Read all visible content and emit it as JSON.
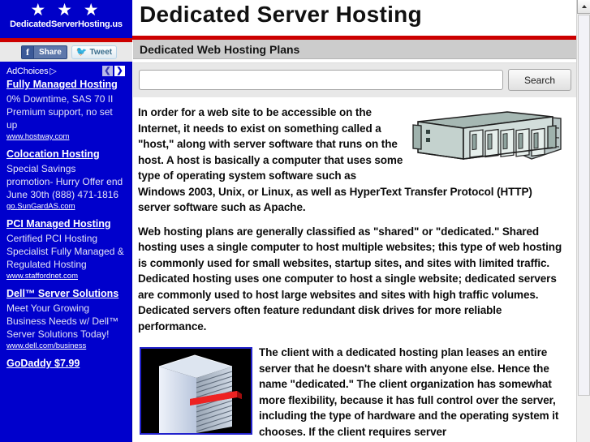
{
  "header": {
    "logo_stars": "★ ★ ★",
    "logo_text": "DedicatedServerHosting.us",
    "site_title": "Dedicated Server Hosting",
    "accent_color": "#cc0000",
    "logo_bg_color": "#0000c8"
  },
  "social": {
    "facebook_f": "f",
    "facebook_label": "Share",
    "twitter_bird": "🐦",
    "twitter_label": "Tweet"
  },
  "sidebar": {
    "adchoices_label": "AdChoices",
    "adchoices_triangle": "▷",
    "prev_arrow": "❮",
    "next_arrow": "❯",
    "bg_color": "#0000cc",
    "ads": [
      {
        "title": "Fully Managed Hosting",
        "desc": "0% Downtime, SAS 70 II Premium support, no set up",
        "url": "www.hostway.com"
      },
      {
        "title": "Colocation Hosting",
        "desc": "Special Savings promotion- Hurry Offer end June 30th (888) 471-1816",
        "url": "go.SunGardAS.com"
      },
      {
        "title": "PCI Managed Hosting",
        "desc": "Certified PCI Hosting Specialist Fully Managed & Regulated Hosting",
        "url": "www.staffordnet.com"
      },
      {
        "title": "Dell™ Server Solutions",
        "desc": "Meet Your Growing Business Needs w/ Dell™ Server Solutions Today!",
        "url": "www.dell.com/business"
      },
      {
        "title": "GoDaddy $7.99",
        "desc": "",
        "url": ""
      }
    ]
  },
  "main": {
    "subheading": "Dedicated Web Hosting Plans",
    "search": {
      "value": "",
      "placeholder": "",
      "button_label": "Search"
    },
    "paragraphs": [
      "In order for a web site to be accessible on the Internet, it needs to exist on something called a \"host,\" along with server software that runs on the host.  A host is basically a computer that uses some type of operating system software such as Windows 2003, Unix, or Linux, as well as HyperText Transfer Protocol (HTTP) server software such as Apache.",
      "Web hosting plans are generally classified as \"shared\" or \"dedicated.\"  Shared hosting uses a single computer to host multiple websites; this type of web hosting is commonly used for small websites, startup sites, and sites with limited traffic.  Dedicated hosting uses one computer to host a single website; dedicated servers are commonly used to host large websites and sites with high traffic volumes.  Dedicated servers often feature redundant disk drives for more reliable performance.",
      "The client with a dedicated hosting plan leases an entire server that he doesn't share with anyone else.  Hence the name \"dedicated.\"  The client organization has somewhat more flexibility, because it has full control over the server, including the type of hardware and the operating system it chooses.  If the client requires server"
    ],
    "images": {
      "rack_server_alt": "rack-server-illustration",
      "tower_server_alt": "tower-server-illustration"
    }
  },
  "scrollbar": {
    "up_arrow": "▲"
  }
}
